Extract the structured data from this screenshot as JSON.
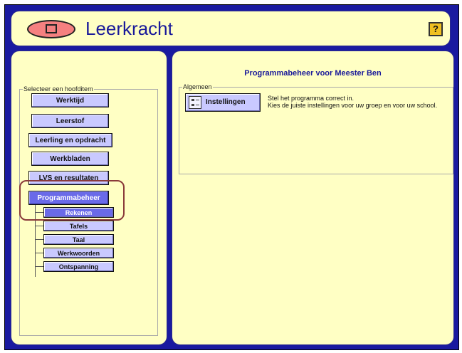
{
  "header": {
    "title": "Leerkracht",
    "help_label": "?"
  },
  "left_panel": {
    "group_label": "Selecteer een hoofditem",
    "items": [
      {
        "label": "Werktijd"
      },
      {
        "label": "Leerstof"
      },
      {
        "label": "Leerling en opdracht"
      },
      {
        "label": "Werkbladen"
      },
      {
        "label": "LVS en resultaten"
      },
      {
        "label": "Programmabeheer"
      }
    ],
    "subitems": [
      {
        "label": "Rekenen"
      },
      {
        "label": "Tafels"
      },
      {
        "label": "Taal"
      },
      {
        "label": "Werkwoorden"
      },
      {
        "label": "Ontspanning"
      }
    ]
  },
  "right_panel": {
    "heading": "Programmabeheer voor Meester Ben",
    "group_label": "Algemeen",
    "setting_button": "Instellingen",
    "desc_line1": "Stel het programma correct in.",
    "desc_line2": "Kies de juiste instellingen voor uw groep en voor uw school."
  },
  "colors": {
    "frame": "#1a1aa0",
    "panel": "#ffffc4",
    "button": "#c9c9ff",
    "active_button": "#6a6ae8",
    "back_button": "#f58080",
    "highlight": "#8a3a3a"
  }
}
